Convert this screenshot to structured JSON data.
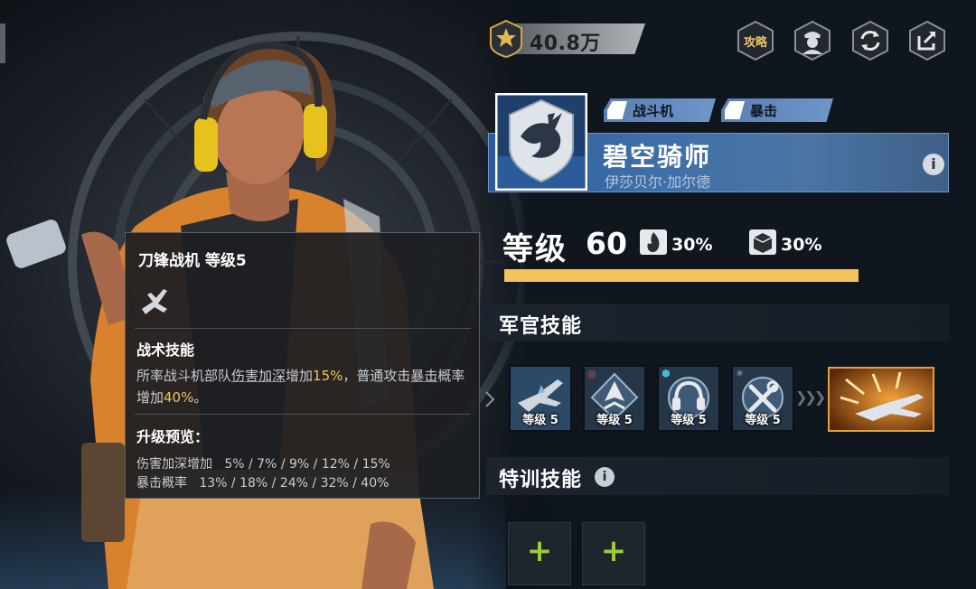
{
  "colors": {
    "accent_gold": "#f2c45a",
    "highlight_text": "#f0c25a",
    "tag_blue": "#6f96c9",
    "namebar_blue": "#3f6fa8",
    "plus_green": "#9acd3c"
  },
  "top_bar": {
    "power_icon": "star-badge-icon",
    "power_value": "40.8万",
    "guide_button_label": "攻略",
    "buttons": [
      {
        "name": "guide",
        "icon": "book-icon"
      },
      {
        "name": "officer-profile",
        "icon": "officer-avatar-icon"
      },
      {
        "name": "swap",
        "icon": "refresh-icon"
      },
      {
        "name": "share",
        "icon": "share-icon"
      }
    ]
  },
  "officer": {
    "emblem_icon": "eagle-emblem-icon",
    "tags": [
      {
        "label": "战斗机",
        "icon": "fighter-jet-icon"
      },
      {
        "label": "暴击",
        "icon": "critical-icon"
      }
    ],
    "name": "碧空骑师",
    "subtitle": "伊莎贝尔·加尔德",
    "level_label": "等级",
    "level": "60",
    "bonuses": [
      {
        "icon": "flame-attack-icon",
        "value": "30%"
      },
      {
        "icon": "shield-defense-icon",
        "value": "30%"
      }
    ],
    "xp_progress": 1.0
  },
  "skills_section": {
    "title": "军官技能",
    "skills": [
      {
        "level_label": "等级 5",
        "icon": "blade-fighter-icon"
      },
      {
        "level_label": "等级 5",
        "icon": "squadron-arrow-icon"
      },
      {
        "level_label": "等级 5",
        "icon": "headset-icon"
      },
      {
        "level_label": "等级 5",
        "icon": "wrench-tools-icon"
      }
    ],
    "ultimate_icon": "missile-barrage-icon"
  },
  "training_section": {
    "title": "特训技能",
    "slots": [
      {
        "label": "+"
      },
      {
        "label": "+"
      }
    ]
  },
  "tooltip": {
    "title": "刀锋战机 等级5",
    "icon": "fighter-jet-icon",
    "tactical_title": "战术技能",
    "desc_parts": {
      "p1": "所率战斗机部队",
      "p2": "伤害加深",
      "p3": "增加",
      "p4": "15%",
      "p5": "，普通攻击",
      "p6": "暴击",
      "p7": "概率增加",
      "p8": "40%",
      "p9": "。"
    },
    "upgrade_title": "升级预览：",
    "upgrade_rows": [
      {
        "label": "伤害加深增加",
        "values": "5% / 7% / 9% / 12% / 15%"
      },
      {
        "label": "暴击概率",
        "values": "13% / 18% / 24% / 32% / 40%"
      }
    ]
  }
}
